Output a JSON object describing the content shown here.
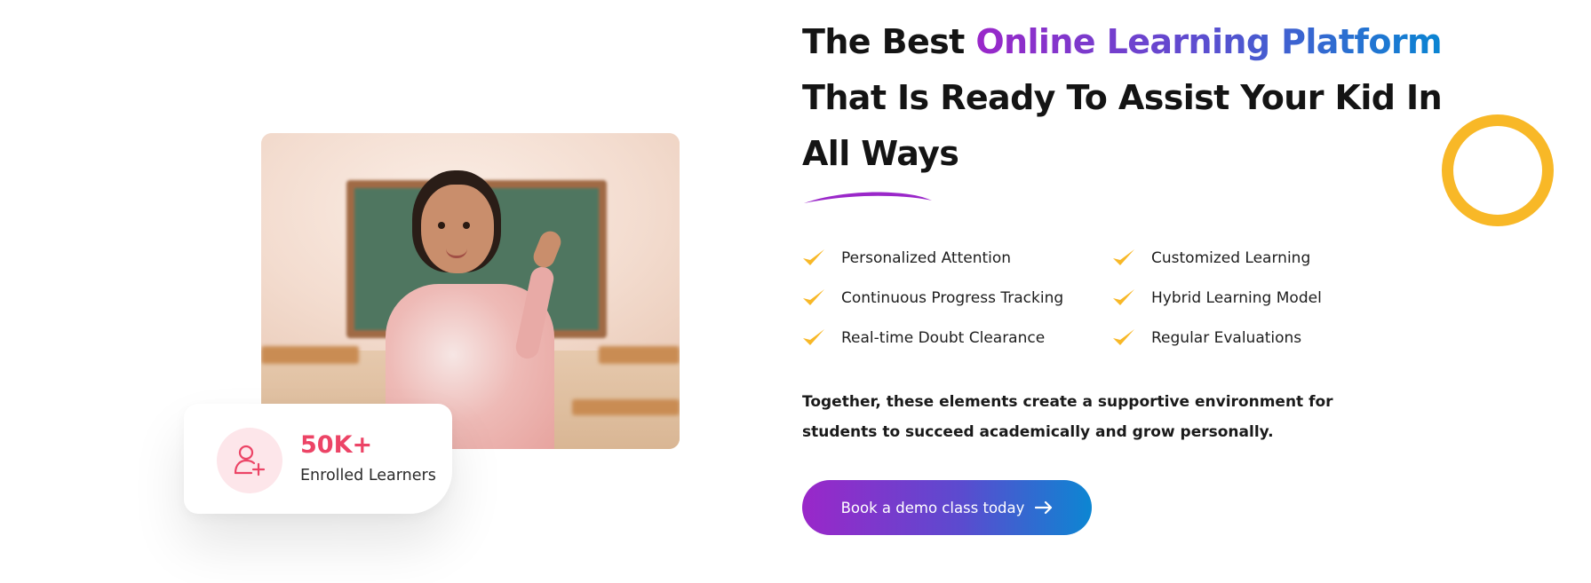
{
  "heading": {
    "part1": "The Best ",
    "highlight": "Online Learning Platform",
    "part2": "That Is Ready To Assist Your Kid In All Ways"
  },
  "features": [
    {
      "label": "Personalized Attention",
      "icon": "check-icon"
    },
    {
      "label": "Customized Learning",
      "icon": "check-icon"
    },
    {
      "label": "Continuous Progress Tracking",
      "icon": "check-icon"
    },
    {
      "label": "Hybrid Learning Model",
      "icon": "check-icon"
    },
    {
      "label": "Real-time Doubt Clearance",
      "icon": "check-icon"
    },
    {
      "label": "Regular Evaluations",
      "icon": "check-icon"
    }
  ],
  "description": "Together, these elements create a supportive environment for students to succeed academically and grow personally.",
  "cta": {
    "label": "Book a demo class today",
    "icon": "arrow-right-icon"
  },
  "stats": {
    "count": "50K+",
    "label": "Enrolled Learners",
    "icon": "add-user-icon"
  },
  "colors": {
    "gradient_start": "#9a27c9",
    "gradient_end": "#0a85d2",
    "check": "#f8b827",
    "ring": "#f8b827",
    "stat": "#ec4466",
    "stat_badge_bg": "#fde6ea"
  }
}
